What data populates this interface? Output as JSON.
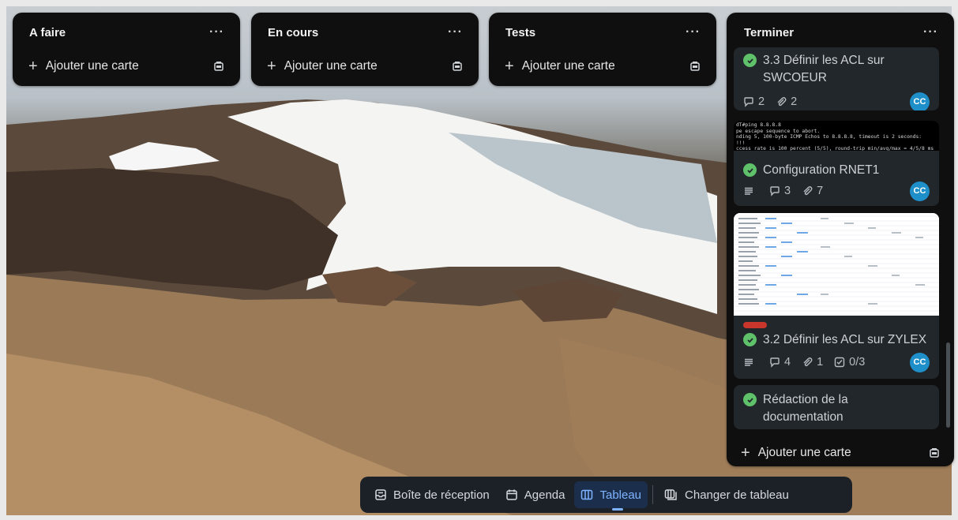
{
  "columns": [
    {
      "title": "A faire",
      "add_label": "Ajouter une carte"
    },
    {
      "title": "En cours",
      "add_label": "Ajouter une carte"
    },
    {
      "title": "Tests",
      "add_label": "Ajouter une carte"
    }
  ],
  "terminer": {
    "title": "Terminer",
    "add_label": "Ajouter une carte",
    "cards": [
      {
        "title": "3.3 Définir les ACL sur SWCOEUR",
        "comments": "2",
        "attachments": "2",
        "member": "CC"
      },
      {
        "title": "Configuration RNET1",
        "comments": "3",
        "attachments": "7",
        "member": "CC",
        "cover_console": "dT#ping 8.8.8.8\npe escape sequence to abort.\nnding 5, 100-byte ICMP Echos to 8.8.8.8, timeout is 2 seconds:\n!!!\nccess rate is 100 percent (5/5), round-trip min/avg/max = 4/5/8 ms"
      },
      {
        "title": "3.2 Définir les ACL sur ZYLEX",
        "comments": "4",
        "attachments": "1",
        "checklist": "0/3",
        "member": "CC",
        "label_color": "#c9372c"
      },
      {
        "title": "Rédaction de la documentation"
      }
    ]
  },
  "nav": {
    "inbox": "Boîte de réception",
    "planner": "Agenda",
    "board": "Tableau",
    "switch": "Changer de tableau"
  },
  "colors": {
    "accent": "#7fb3ff",
    "avatar": "#1f8fc9",
    "done": "#5fc26a"
  }
}
